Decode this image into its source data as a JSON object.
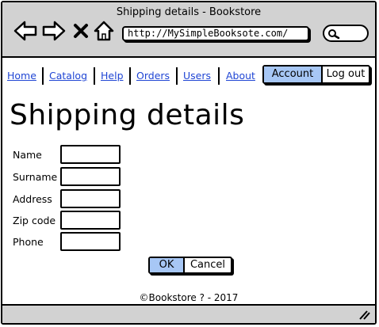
{
  "window": {
    "title": "Shipping details - Bookstore"
  },
  "address_bar": {
    "url": "http://MySimpleBooksote.com/"
  },
  "menu": {
    "items": [
      {
        "label": "Home"
      },
      {
        "label": "Catalog"
      },
      {
        "label": "Help"
      },
      {
        "label": "Orders"
      },
      {
        "label": "Users"
      },
      {
        "label": "About"
      }
    ],
    "account_label": "Account",
    "logout_label": "Log out"
  },
  "page": {
    "title": "Shipping details"
  },
  "form": {
    "fields": [
      {
        "label": "Name",
        "value": ""
      },
      {
        "label": "Surname",
        "value": ""
      },
      {
        "label": "Address",
        "value": ""
      },
      {
        "label": "Zip code",
        "value": ""
      },
      {
        "label": "Phone",
        "value": ""
      }
    ],
    "ok_label": "OK",
    "cancel_label": "Cancel"
  },
  "footer": {
    "text": "©Bookstore ? - 2017"
  },
  "colors": {
    "chrome": "#d2d2d2",
    "link": "#1f45d4",
    "active_button": "#a7c7f5"
  }
}
